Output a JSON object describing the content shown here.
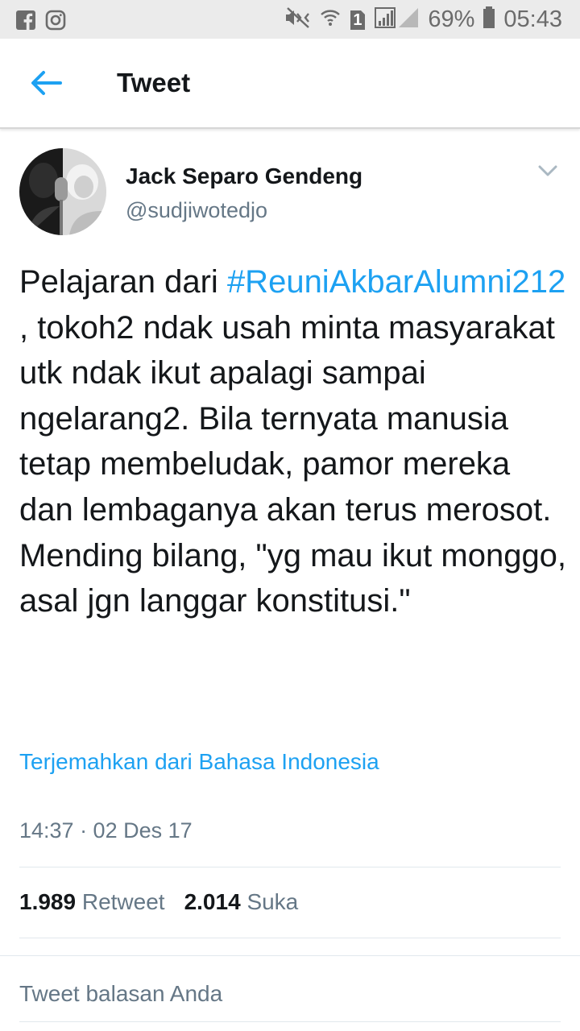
{
  "status_bar": {
    "battery": "69%",
    "time": "05:43",
    "left_icons": [
      "facebook-icon",
      "instagram-icon"
    ],
    "right_icons": [
      "mute-icon",
      "wifi-icon",
      "sim-icon",
      "signal-icon",
      "battery-icon"
    ],
    "sim_slot": "1"
  },
  "app_bar": {
    "title": "Tweet",
    "back_icon": "arrow-left-icon"
  },
  "tweet": {
    "author_name": "Jack Separo Gendeng",
    "handle": "@sudjiwotedjo",
    "text_before": "Pelajaran dari ",
    "hashtag": "#ReuniAkbarAlumni212",
    "text_after": " , tokoh2 ndak usah minta masyarakat utk ndak ikut apalagi sampai ngelarang2. Bila ternyata manusia tetap membeludak, pamor mereka dan lembaganya akan terus merosot. Mending bilang, \"yg mau ikut monggo, asal jgn langgar konstitusi.\"",
    "translate_link": "Terjemahkan dari Bahasa Indonesia",
    "timestamp": "14:37 · 02 Des 17",
    "retweets_count": "1.989",
    "retweets_label": "Retweet",
    "likes_count": "2.014",
    "likes_label": "Suka"
  },
  "reply": {
    "placeholder": "Tweet balasan Anda"
  },
  "colors": {
    "accent": "#1da1f2",
    "secondary_text": "#657786",
    "primary_text": "#14171a",
    "status_bar_bg": "#ebebeb"
  }
}
